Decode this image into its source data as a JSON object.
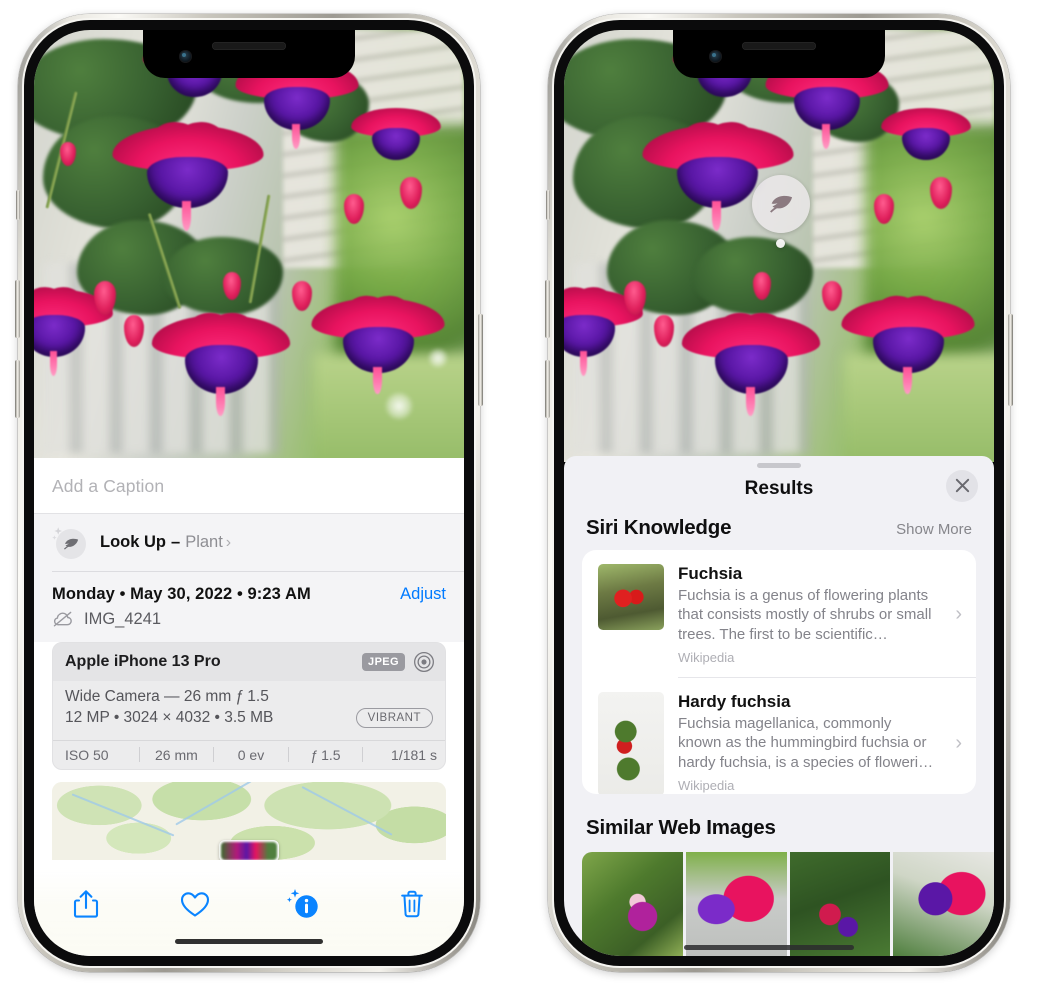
{
  "left_phone": {
    "caption": {
      "placeholder": "Add a Caption",
      "value": ""
    },
    "lookup": {
      "icon": "leaf-sparkle-icon",
      "title": "Look Up",
      "dash": "–",
      "subject": "Plant",
      "chevron": "›"
    },
    "details": {
      "date_line": "Monday • May 30, 2022 • 9:23 AM",
      "adjust_label": "Adjust",
      "cloud_icon": "cloud-slash-icon",
      "file_name": "IMG_4241"
    },
    "exif": {
      "device": "Apple iPhone 13 Pro",
      "format_badge": "JPEG",
      "lens_icon": "aperture-icon",
      "lens_line": "Wide Camera — 26 mm ƒ 1.5",
      "specs_line": "12 MP • 3024 × 4032 • 3.5 MB",
      "style_pill": "VIBRANT",
      "stats": [
        "ISO 50",
        "26 mm",
        "0 ev",
        "ƒ 1.5",
        "1/181 s"
      ]
    },
    "map": {
      "pin_label": "photo-thumbnail-pin"
    },
    "toolbar": [
      {
        "name": "share-icon",
        "label": "Share"
      },
      {
        "name": "favorite-heart-icon",
        "label": "Favorite"
      },
      {
        "name": "info-sparkle-icon",
        "label": "Info"
      },
      {
        "name": "trash-icon",
        "label": "Delete"
      }
    ]
  },
  "right_phone": {
    "badge": {
      "icon": "leaf-icon"
    },
    "sheet": {
      "grabber": "sheet-grabber",
      "title": "Results",
      "close_icon": "close-x-icon"
    },
    "siri_knowledge": {
      "title": "Siri Knowledge",
      "show_more": "Show More",
      "items": [
        {
          "title": "Fuchsia",
          "description": "Fuchsia is a genus of flowering plants that consists mostly of shrubs or small trees. The first to be scientific…",
          "source": "Wikipedia",
          "chevron": "›"
        },
        {
          "title": "Hardy fuchsia",
          "description": "Fuchsia magellanica, commonly known as the hummingbird fuchsia or hardy fuchsia, is a species of floweri…",
          "source": "Wikipedia",
          "chevron": "›"
        }
      ]
    },
    "similar_web_images": {
      "title": "Similar Web Images",
      "thumbnails": [
        "fuchsia-pink-white-bloom",
        "fuchsia-red-closeup",
        "fuchsia-bush-buds",
        "fuchsia-purple-double"
      ]
    }
  },
  "colors": {
    "accent_blue": "#007aff",
    "sheet_bg": "#f1f1f5",
    "card_bg": "#ffffff",
    "secondary_text": "#8e8e93"
  }
}
